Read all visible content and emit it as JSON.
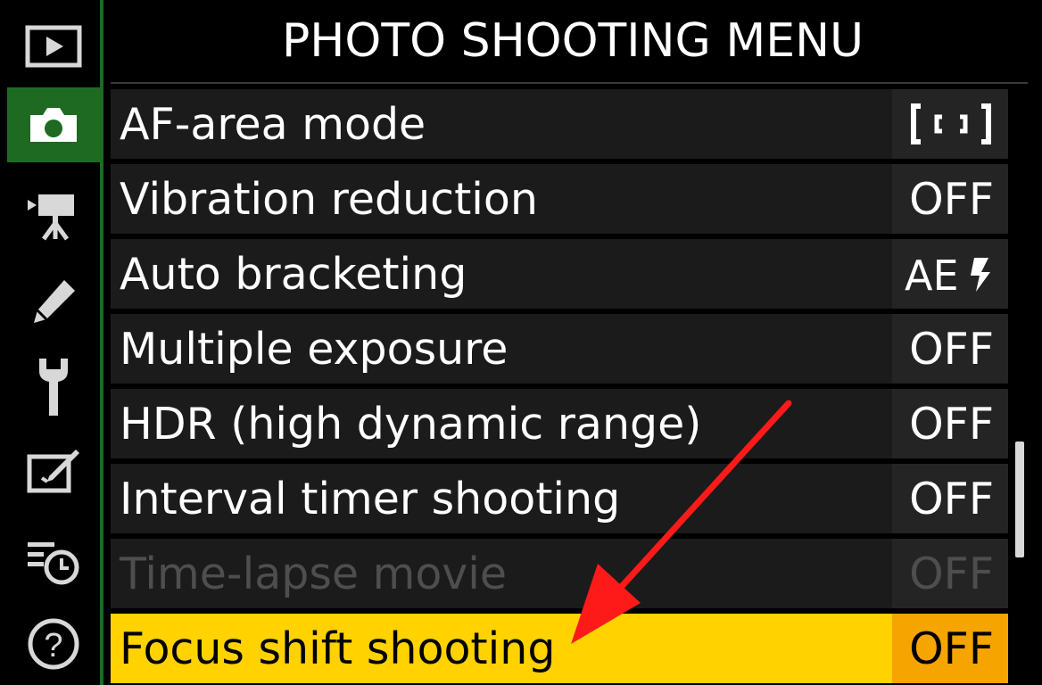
{
  "header": {
    "title": "PHOTO SHOOTING MENU"
  },
  "sidebar": {
    "items": [
      {
        "icon": "playback-icon",
        "active": false
      },
      {
        "icon": "camera-icon",
        "active": true
      },
      {
        "icon": "movie-camera-icon",
        "active": false
      },
      {
        "icon": "pencil-icon",
        "active": false
      },
      {
        "icon": "wrench-icon",
        "active": false
      },
      {
        "icon": "retouch-icon",
        "active": false
      },
      {
        "icon": "recent-settings-icon",
        "active": false
      },
      {
        "icon": "help-icon",
        "active": false,
        "text": "?"
      }
    ]
  },
  "menu": {
    "items": [
      {
        "label": "AF-area mode",
        "value": "[▪▪]",
        "value_icon": "single-point-af-icon",
        "state": "normal"
      },
      {
        "label": "Vibration reduction",
        "value": "OFF",
        "state": "normal"
      },
      {
        "label": "Auto bracketing",
        "value": "AE⚡",
        "value_icon": "ae-flash-bracketing-icon",
        "state": "normal"
      },
      {
        "label": "Multiple exposure",
        "value": "OFF",
        "state": "normal"
      },
      {
        "label": "HDR (high dynamic range)",
        "value": "OFF",
        "state": "normal"
      },
      {
        "label": "Interval timer shooting",
        "value": "OFF",
        "state": "normal"
      },
      {
        "label": "Time-lapse movie",
        "value": "OFF",
        "state": "disabled"
      },
      {
        "label": "Focus shift shooting",
        "value": "OFF",
        "state": "selected"
      }
    ]
  },
  "colors": {
    "accent_green": "#1f6a22",
    "selected_label_bg": "#ffd200",
    "selected_value_bg": "#f6a500",
    "annotation_arrow": "#ff1a1a"
  }
}
